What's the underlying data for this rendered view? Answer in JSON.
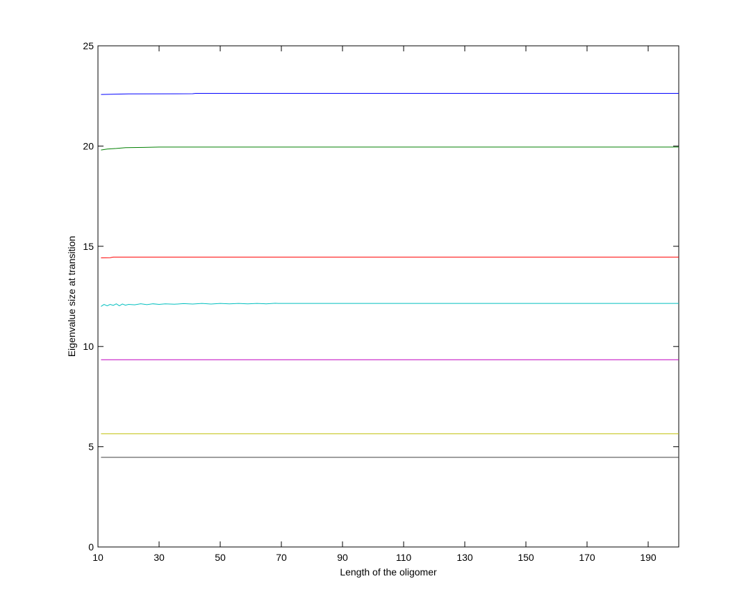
{
  "chart_data": {
    "type": "line",
    "title": "",
    "xlabel": "Length of the oligomer",
    "ylabel": "Eigenvalue size at transition",
    "xlim": [
      10,
      200
    ],
    "ylim": [
      0,
      25
    ],
    "xticks": [
      10,
      30,
      50,
      70,
      90,
      110,
      130,
      150,
      170,
      190
    ],
    "yticks": [
      0,
      5,
      10,
      15,
      20,
      25
    ],
    "xtick_labels": [
      "10",
      "30",
      "50",
      "70",
      "90",
      "110",
      "130",
      "150",
      "170",
      "190"
    ],
    "ytick_labels": [
      "0",
      "5",
      "10",
      "15",
      "20",
      "25"
    ],
    "grid": false,
    "legend": "none",
    "series": [
      {
        "color": "#0000ff",
        "points": [
          [
            11,
            22.57
          ],
          [
            20,
            22.6
          ],
          [
            41,
            22.61
          ],
          [
            42,
            22.63
          ],
          [
            200,
            22.63
          ]
        ]
      },
      {
        "color": "#007f00",
        "points": [
          [
            11,
            19.8
          ],
          [
            13,
            19.85
          ],
          [
            16,
            19.88
          ],
          [
            19,
            19.92
          ],
          [
            25,
            19.93
          ],
          [
            30,
            19.95
          ],
          [
            200,
            19.95
          ]
        ]
      },
      {
        "color": "#ff0000",
        "points": [
          [
            11,
            14.42
          ],
          [
            14,
            14.43
          ],
          [
            15,
            14.46
          ],
          [
            200,
            14.46
          ]
        ]
      },
      {
        "color": "#00bfbf",
        "points": [
          [
            11,
            12.0
          ],
          [
            12,
            12.1
          ],
          [
            13,
            12.03
          ],
          [
            14,
            12.1
          ],
          [
            15,
            12.05
          ],
          [
            16,
            12.13
          ],
          [
            17,
            12.03
          ],
          [
            18,
            12.12
          ],
          [
            19,
            12.06
          ],
          [
            20,
            12.1
          ],
          [
            22,
            12.08
          ],
          [
            24,
            12.13
          ],
          [
            26,
            12.09
          ],
          [
            28,
            12.13
          ],
          [
            30,
            12.1
          ],
          [
            32,
            12.13
          ],
          [
            35,
            12.11
          ],
          [
            38,
            12.14
          ],
          [
            41,
            12.12
          ],
          [
            44,
            12.15
          ],
          [
            47,
            12.12
          ],
          [
            50,
            12.15
          ],
          [
            53,
            12.13
          ],
          [
            56,
            12.15
          ],
          [
            59,
            12.13
          ],
          [
            62,
            12.15
          ],
          [
            65,
            12.13
          ],
          [
            68,
            12.16
          ],
          [
            69,
            12.15
          ],
          [
            200,
            12.15
          ]
        ]
      },
      {
        "color": "#bf00bf",
        "points": [
          [
            11,
            9.34
          ],
          [
            200,
            9.34
          ]
        ]
      },
      {
        "color": "#bfbf00",
        "points": [
          [
            11,
            5.65
          ],
          [
            200,
            5.65
          ]
        ]
      },
      {
        "color": "#3f3f3f",
        "points": [
          [
            11,
            4.47
          ],
          [
            200,
            4.47
          ]
        ]
      }
    ]
  }
}
